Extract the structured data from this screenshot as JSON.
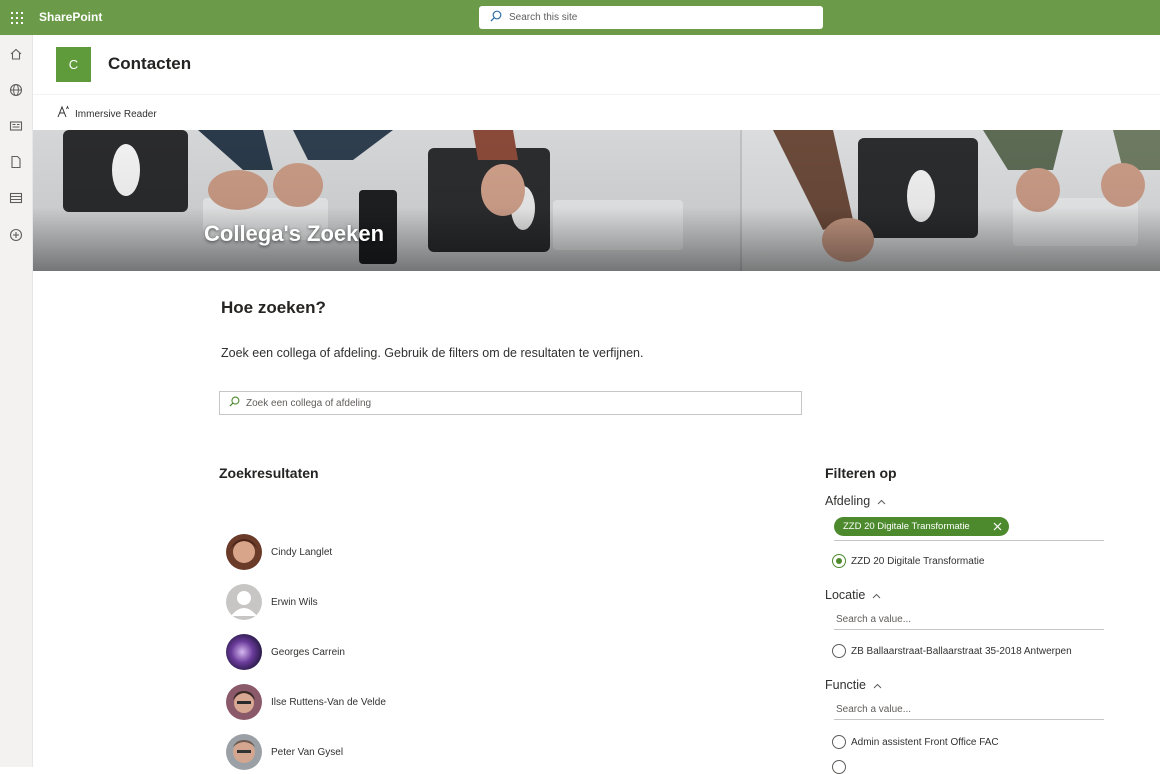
{
  "suite": {
    "brand": "SharePoint",
    "search_placeholder": "Search this site"
  },
  "appbar": {
    "items": [
      "home-icon",
      "globe-icon",
      "news-icon",
      "document-icon",
      "list-icon",
      "add-icon"
    ]
  },
  "site": {
    "logo_letter": "C",
    "title": "Contacten",
    "immersive_reader": "Immersive Reader"
  },
  "hero": {
    "title": "Collega's Zoeken"
  },
  "intro": {
    "heading": "Hoe zoeken?",
    "text": "Zoek een collega of afdeling. Gebruik de filters om de resultaten te verfijnen.",
    "search_placeholder": "Zoek een collega of afdeling"
  },
  "results": {
    "heading": "Zoekresultaten",
    "people": [
      {
        "name": "Cindy Langlet"
      },
      {
        "name": "Erwin Wils"
      },
      {
        "name": "Georges Carrein"
      },
      {
        "name": "Ilse Ruttens-Van de Velde"
      },
      {
        "name": "Peter Van Gysel"
      }
    ]
  },
  "filters": {
    "heading": "Filteren op",
    "afdeling": {
      "label": "Afdeling",
      "selected_pill": "ZZD 20 Digitale Transformatie",
      "options": [
        "ZZD 20 Digitale Transformatie"
      ]
    },
    "locatie": {
      "label": "Locatie",
      "search_placeholder": "Search a value...",
      "options": [
        "ZB Ballaarstraat-Ballaarstraat 35-2018 Antwerpen"
      ]
    },
    "functie": {
      "label": "Functie",
      "search_placeholder": "Search a value...",
      "options": [
        "Admin assistent Front Office FAC"
      ]
    }
  },
  "colors": {
    "suite_bar": "#6b9a49",
    "accent": "#4d8a2e"
  }
}
